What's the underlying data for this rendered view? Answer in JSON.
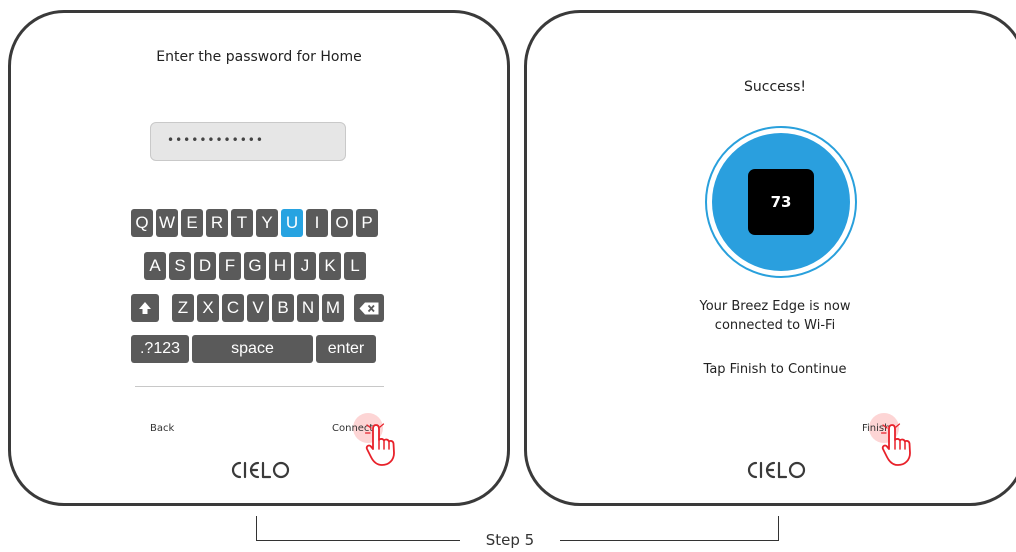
{
  "left_screen": {
    "title": "Enter the password for Home",
    "password_value": "••••••••••••",
    "keyboard": {
      "row1": [
        "Q",
        "W",
        "E",
        "R",
        "T",
        "Y",
        "U",
        "I",
        "O",
        "P"
      ],
      "row2": [
        "A",
        "S",
        "D",
        "F",
        "G",
        "H",
        "J",
        "K",
        "L"
      ],
      "row3": [
        "Z",
        "X",
        "C",
        "V",
        "B",
        "N",
        "M"
      ],
      "active_key": "U",
      "numeric_key": ".?123",
      "space_key": "space",
      "enter_key": "enter"
    },
    "back_label": "Back",
    "connect_label": "Connect"
  },
  "right_screen": {
    "title": "Success!",
    "temperature": "73",
    "message_line1": "Your Breez Edge is now",
    "message_line2": "connected to Wi-Fi",
    "instruction": "Tap Finish to Continue",
    "finish_label": "Finish"
  },
  "brand": "CIELO",
  "step_label": "Step 5",
  "colors": {
    "accent": "#27a3e1",
    "key": "#5a5a5a",
    "tap_highlight": "#f88888",
    "frame": "#3a3a3a"
  }
}
